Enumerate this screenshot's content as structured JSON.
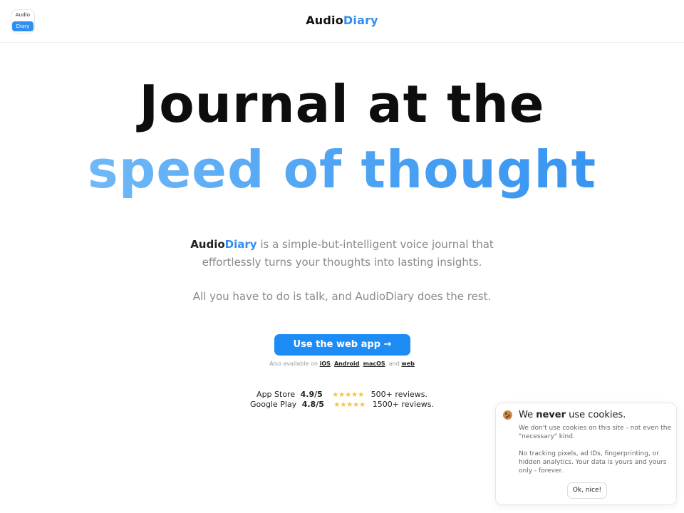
{
  "header": {
    "logo": {
      "top_text": "Audio",
      "bottom_text": "Diary"
    },
    "brand": {
      "part1": "Audio",
      "part2": "Diary"
    }
  },
  "hero": {
    "line1": "Journal at the",
    "line2": "speed of thought"
  },
  "description": {
    "brand_part1": "Audio",
    "brand_part2": "Diary",
    "line1_rest": " is a simple-but-intelligent voice journal that",
    "line2": "effortlessly turns your thoughts into lasting insights.",
    "line3": "All you have to do is talk, and AudioDiary does the rest."
  },
  "cta": {
    "label": "Use the web app →"
  },
  "availability": {
    "prefix": "Also available on ",
    "platforms": [
      "iOS",
      "Android",
      "macOS",
      "web"
    ],
    "sep1": ", ",
    "sep2": ", ",
    "sep3": ", and "
  },
  "ratings": [
    {
      "store": "App Store",
      "score": "4.9/5",
      "stars": "★★★★★",
      "reviews": "500+ reviews."
    },
    {
      "store": "Google Play",
      "score": "4.8/5",
      "stars": "★★★★★",
      "reviews": "1500+ reviews."
    }
  ],
  "cookie": {
    "title_pre": "We ",
    "title_bold": "never",
    "title_post": " use cookies.",
    "para1": "We don't use cookies on this site - not even the \"necessary\" kind.",
    "para2": "No tracking pixels, ad IDs, fingerprinting, or hidden analytics. Your data is yours and yours only - forever.",
    "button": "Ok, nice!"
  },
  "colors": {
    "accent": "#2f8ff0",
    "button": "#1e8cf5",
    "star": "#f3c24a"
  }
}
